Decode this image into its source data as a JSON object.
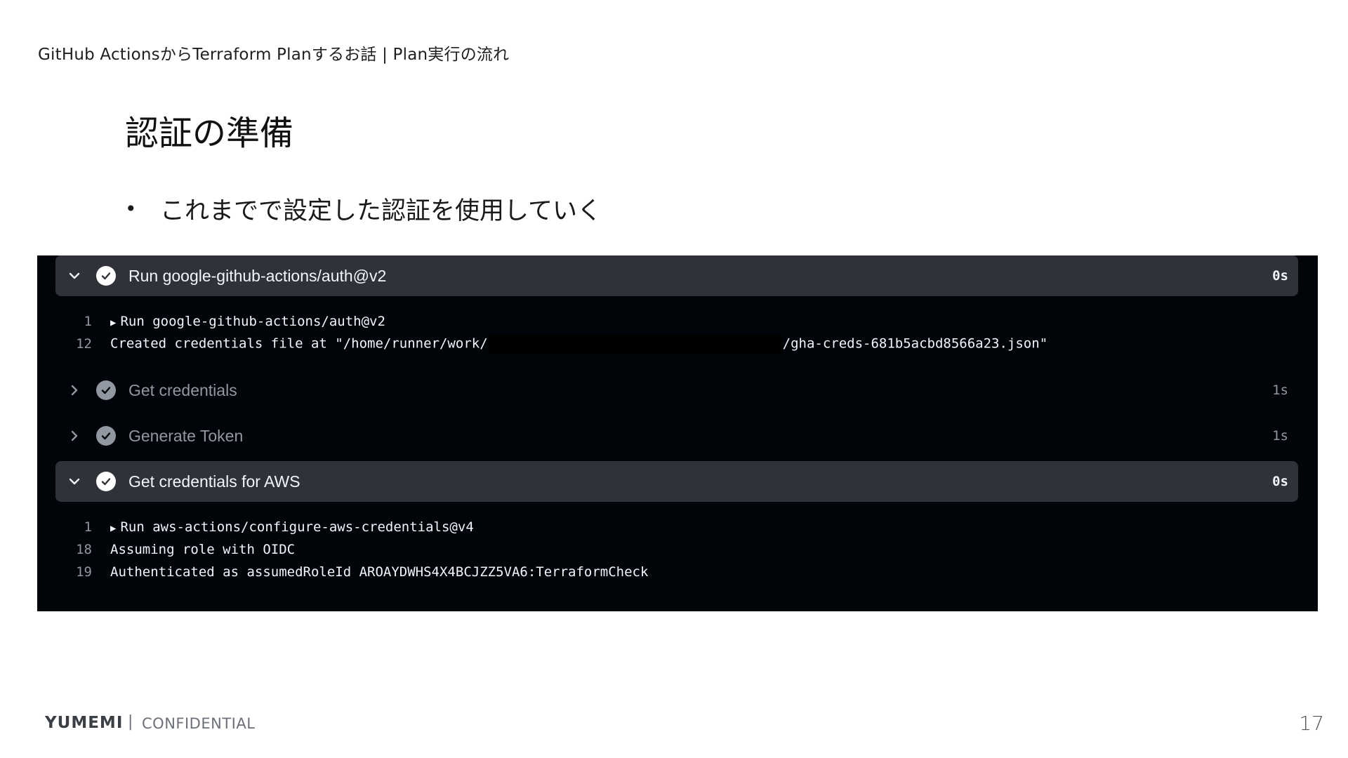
{
  "header": {
    "breadcrumb": "GitHub ActionsからTerraform Planするお話 | Plan実行の流れ"
  },
  "slide": {
    "title": "認証の準備",
    "bullets": [
      "これまでで設定した認証を使用していく"
    ]
  },
  "log": {
    "steps": [
      {
        "title": "Run google-github-actions/auth@v2",
        "time": "0s",
        "expanded": true,
        "lines": [
          {
            "no": "1",
            "prefix": "▶ ",
            "text": "Run google-github-actions/auth@v2"
          },
          {
            "no": "12",
            "text_before": "Created credentials file at \"/home/runner/work/",
            "text_after": "/gha-creds-681b5acbd8566a23.json\""
          }
        ]
      },
      {
        "title": "Get credentials",
        "time": "1s",
        "expanded": false
      },
      {
        "title": "Generate Token",
        "time": "1s",
        "expanded": false
      },
      {
        "title": "Get credentials for AWS",
        "time": "0s",
        "expanded": true,
        "lines": [
          {
            "no": "1",
            "prefix": "▶ ",
            "text": "Run aws-actions/configure-aws-credentials@v4"
          },
          {
            "no": "18",
            "text": "Assuming role with OIDC"
          },
          {
            "no": "19",
            "text": "Authenticated as assumedRoleId AROAYDWHS4X4BCJZZ5VA6:TerraformCheck"
          }
        ]
      }
    ]
  },
  "footer": {
    "logo": "YUMEMI",
    "separator": "|",
    "confidential": "CONFIDENTIAL",
    "page_number": "17"
  }
}
